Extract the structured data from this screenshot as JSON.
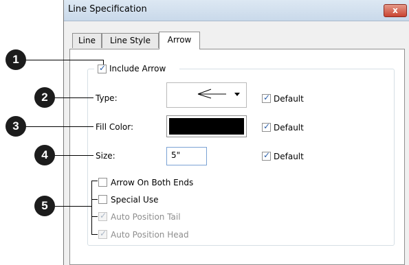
{
  "dialog": {
    "title": "Line Specification",
    "close_label": "x",
    "tabs": [
      {
        "label": "Line"
      },
      {
        "label": "Line Style"
      },
      {
        "label": "Arrow"
      }
    ],
    "active_tab": "Arrow"
  },
  "arrow_tab": {
    "include_arrow": {
      "label": "Include Arrow",
      "checked": true
    },
    "type": {
      "label": "Type:",
      "default_label": "Default",
      "default_checked": true
    },
    "fill_color": {
      "label": "Fill Color:",
      "value": "#000000",
      "default_label": "Default",
      "default_checked": true
    },
    "size": {
      "label": "Size:",
      "value": "5\"",
      "default_label": "Default",
      "default_checked": true
    },
    "options": [
      {
        "label": "Arrow On Both Ends",
        "checked": false,
        "enabled": true
      },
      {
        "label": "Special Use",
        "checked": false,
        "enabled": true
      },
      {
        "label": "Auto Position Tail",
        "checked": true,
        "enabled": false
      },
      {
        "label": "Auto Position Head",
        "checked": true,
        "enabled": false
      }
    ]
  },
  "callouts": [
    "1",
    "2",
    "3",
    "4",
    "5"
  ],
  "colors": {
    "callout": "#1c1c1c",
    "checkmark": "#2b5ea8",
    "close_button": "#c94432"
  }
}
